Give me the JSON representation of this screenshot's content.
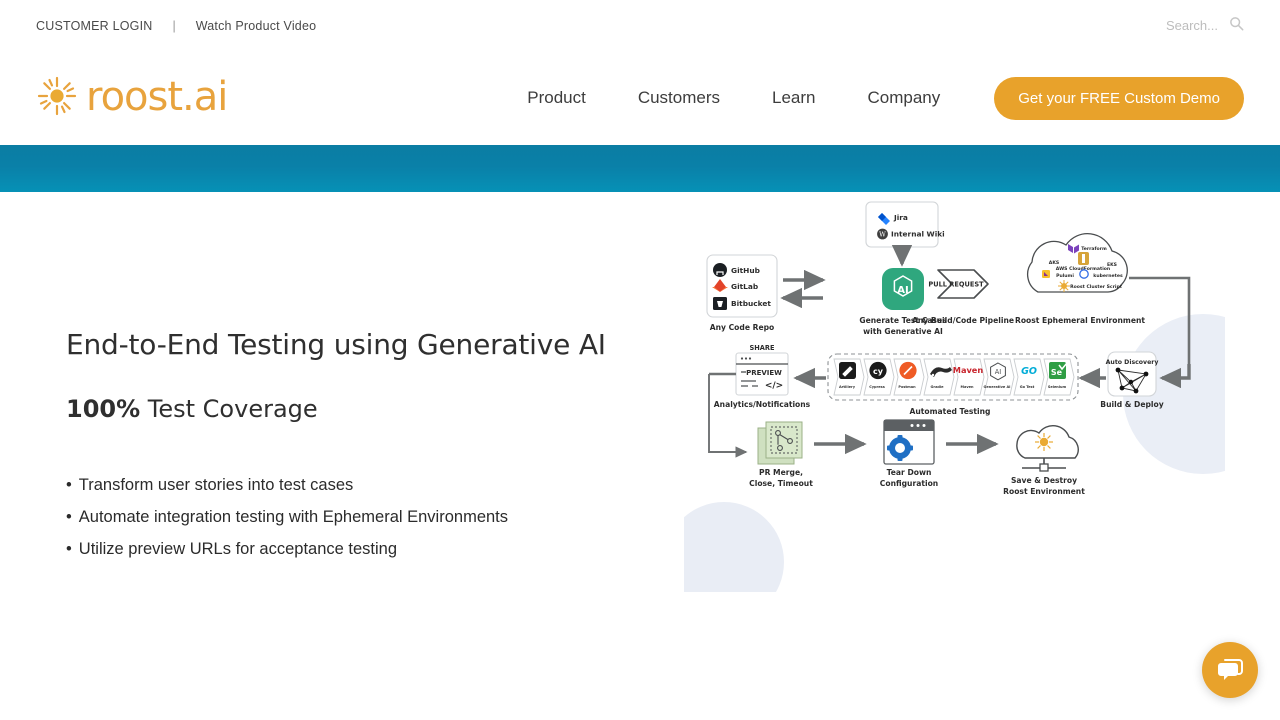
{
  "topbar": {
    "customer_login": "CUSTOMER LOGIN",
    "separator": "|",
    "watch_video": "Watch Product Video",
    "search_placeholder": "Search...",
    "search_value": "",
    "search_icon": "search-icon"
  },
  "nav": {
    "logo_text": "roost.ai",
    "logo_icon": "sun-icon",
    "links": [
      {
        "label": "Product"
      },
      {
        "label": "Customers"
      },
      {
        "label": "Learn"
      },
      {
        "label": "Company"
      }
    ],
    "cta_label": "Get your FREE Custom Demo"
  },
  "colors": {
    "brand_orange": "#e8a22b",
    "teal_strip": "#0b7da3",
    "heading": "#2f2f2f",
    "blob": "#eaeef6",
    "ai_green": "#2fa77e",
    "arrow_gray": "#6f7273"
  },
  "hero": {
    "title": "End-to-End Testing using Generative AI",
    "subtitle_strong": "100%",
    "subtitle_rest": " Test Coverage",
    "bullets": [
      "Transform user stories into test cases",
      "Automate integration testing with Ephemeral Environments",
      "Utilize preview URLs for acceptance testing"
    ]
  },
  "diagram": {
    "nodes": {
      "jira": {
        "label": "Jira",
        "icon": "jira-icon"
      },
      "internal_wiki": {
        "label": "Internal Wiki",
        "icon": "wiki-icon"
      },
      "repo_items": [
        {
          "label": "GitHub",
          "icon": "github-icon"
        },
        {
          "label": "GitLab",
          "icon": "gitlab-icon"
        },
        {
          "label": "Bitbucket",
          "icon": "bitbucket-icon"
        }
      ],
      "repo_caption": "Any Code Repo",
      "ai_badge": "AI",
      "ai_caption_line1": "Generate Test Cases",
      "ai_caption_line2": "with Generative AI",
      "pull_request_label": "PULL REQUEST",
      "pipeline_caption": "Any Build/Code Pipeline",
      "cloud_terraform": "Terraform",
      "cloud_aks": "AKS",
      "cloud_eks": "EKS",
      "cloud_cloudformation": "AWS CloudFormation",
      "cloud_pulumi": "Pulumi",
      "cloud_kubernetes": "kubernetes",
      "cloud_roost_script": "Roost Cluster Script",
      "cloud_caption": "Roost Ephemeral Environment",
      "auto_discovery_label": "Auto Discovery",
      "build_deploy_caption": "Build & Deploy",
      "share_label": "SHARE",
      "preview_label": "PREVIEW",
      "code_glyph": "</>",
      "analytics_caption": "Analytics/Notifications",
      "pr_merge_line1": "PR Merge,",
      "pr_merge_line2": "Close, Timeout",
      "teardown_line1": "Tear Down",
      "teardown_line2": "Configuration",
      "save_destroy_line1": "Save & Destroy",
      "save_destroy_line2": "Roost Environment",
      "automated_testing_caption": "Automated Testing"
    },
    "test_tools": [
      {
        "label": "Artillery",
        "icon": "artillery-icon"
      },
      {
        "label": "Cypress",
        "icon": "cypress-icon"
      },
      {
        "label": "Postman",
        "icon": "postman-icon"
      },
      {
        "label": "Gradle",
        "icon": "gradle-icon"
      },
      {
        "label": "Maven",
        "icon": "maven-icon"
      },
      {
        "label": "Generative AI",
        "icon": "generative-ai-icon"
      },
      {
        "label": "Go Test",
        "icon": "go-icon"
      },
      {
        "label": "Selenium",
        "icon": "selenium-icon"
      }
    ]
  },
  "chat": {
    "icon": "chat-bubble-icon",
    "label": "Open chat"
  }
}
